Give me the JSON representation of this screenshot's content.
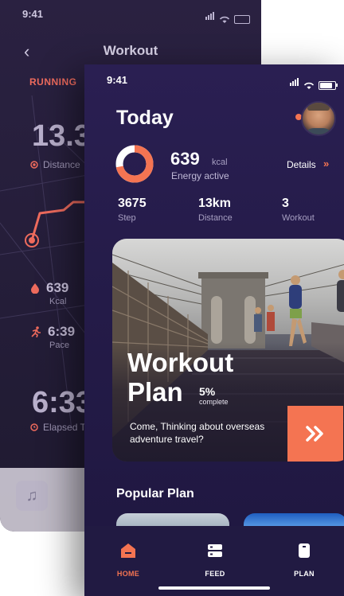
{
  "back_screen": {
    "status_time": "9:41",
    "title": "Workout",
    "mode": "RUNNING",
    "distance_value": "13.3",
    "distance_label": "Distance",
    "kcal_value": "639",
    "kcal_label": "Kcal",
    "pace_value": "6:39",
    "pace_label": "Pace",
    "elapsed_value": "6:33",
    "elapsed_label": "Elapsed T"
  },
  "front_screen": {
    "status_time": "9:41",
    "heading": "Today",
    "energy": {
      "value": "639",
      "unit": "kcal",
      "label": "Energy active",
      "ring_fraction": 0.72
    },
    "details_label": "Details",
    "metrics": [
      {
        "value": "3675",
        "label": "Step"
      },
      {
        "value": "13km",
        "label": "Distance"
      },
      {
        "value": "3",
        "label": "Workout"
      }
    ],
    "workout_plan": {
      "title_line1": "Workout",
      "title_line2": "Plan",
      "percent": "5%",
      "percent_label": "complete",
      "description": "Come, Thinking about overseas adventure travel?"
    },
    "popular_heading": "Popular Plan",
    "tabs": [
      {
        "label": "HOME",
        "active": true
      },
      {
        "label": "FEED",
        "active": false
      },
      {
        "label": "PLAN",
        "active": false
      }
    ]
  },
  "colors": {
    "accent": "#f47452",
    "background": "#241b48",
    "tab_inactive": "#ffffff"
  }
}
